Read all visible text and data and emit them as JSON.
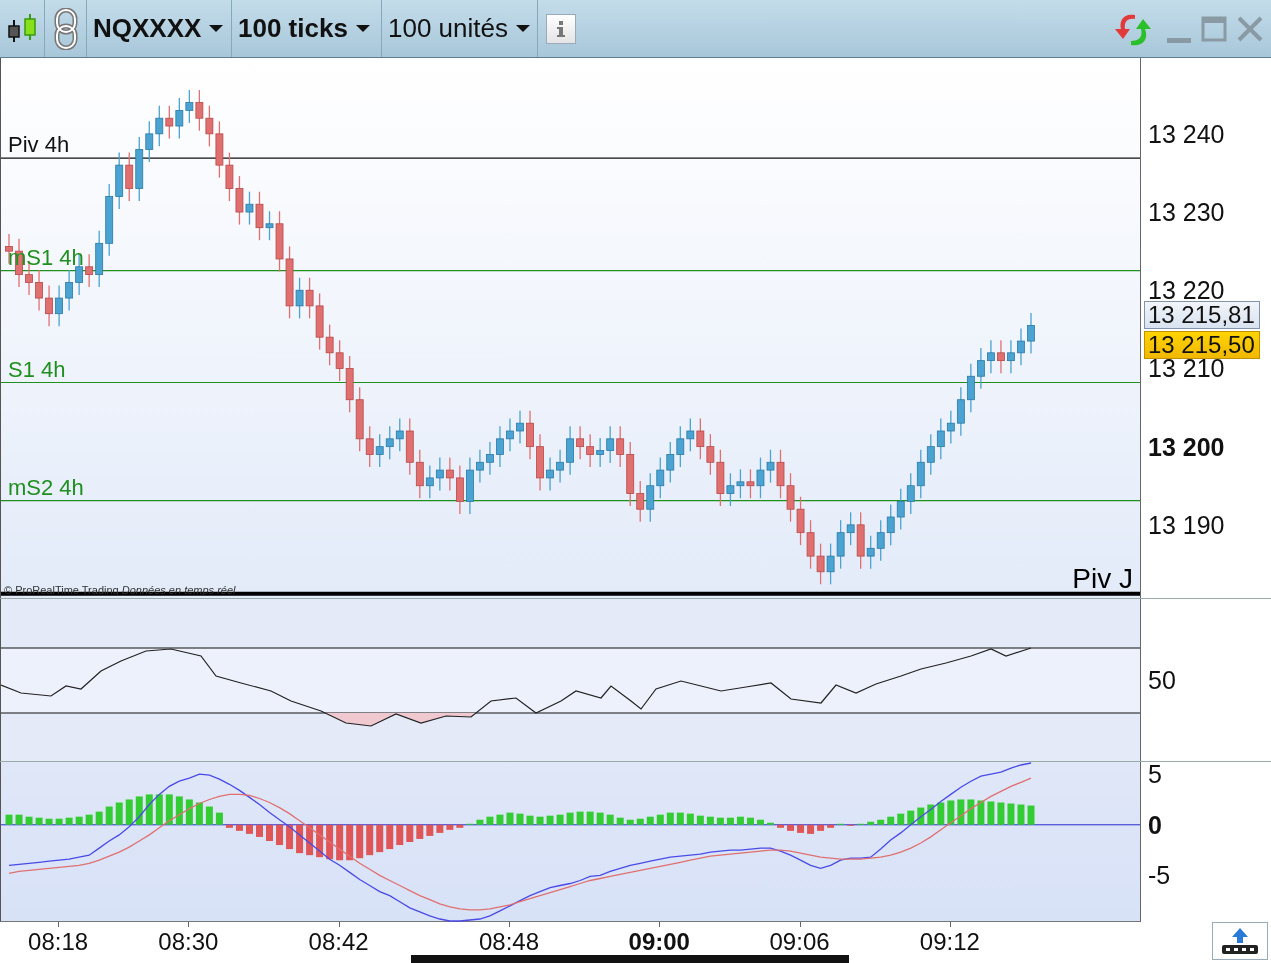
{
  "toolbar": {
    "instrument": {
      "label": "NQXXXX"
    },
    "interval": {
      "label": "100 ticks"
    },
    "quantity": {
      "label": "100 unités"
    }
  },
  "price_chart": {
    "axis_labels": [
      {
        "text": "13 240",
        "bold": false
      },
      {
        "text": "13 230",
        "bold": false
      },
      {
        "text": "13 220",
        "bold": false
      },
      {
        "text": "13 210",
        "bold": false
      },
      {
        "text": "13 200",
        "bold": true
      },
      {
        "text": "13 190",
        "bold": false
      }
    ],
    "levels": [
      {
        "label": "Piv 4h",
        "color": "#111111"
      },
      {
        "label": "mS1 4h",
        "color": "#1f8f1f"
      },
      {
        "label": "S1 4h",
        "color": "#1f8f1f"
      },
      {
        "label": "mS2 4h",
        "color": "#1f8f1f"
      }
    ],
    "pivot_label": "Piv J",
    "price_tags": [
      {
        "text": "13 215,81",
        "kind": "last"
      },
      {
        "text": "13 215,50",
        "kind": "current"
      }
    ],
    "copyright": "© ProRealTime Trading *Données en temps réel*"
  },
  "oscillator_panel": {
    "axis_label": "50"
  },
  "macd_panel": {
    "axis_labels": [
      {
        "text": "5",
        "bold": false
      },
      {
        "text": "0",
        "bold": true
      },
      {
        "text": "-5",
        "bold": false
      }
    ]
  },
  "time_axis": [
    {
      "label": "08:18",
      "bold": false
    },
    {
      "label": "08:30",
      "bold": false
    },
    {
      "label": "08:42",
      "bold": false
    },
    {
      "label": "08:48",
      "bold": false
    },
    {
      "label": "09:00",
      "bold": true
    },
    {
      "label": "09:06",
      "bold": false
    },
    {
      "label": "09:12",
      "bold": false
    }
  ]
}
